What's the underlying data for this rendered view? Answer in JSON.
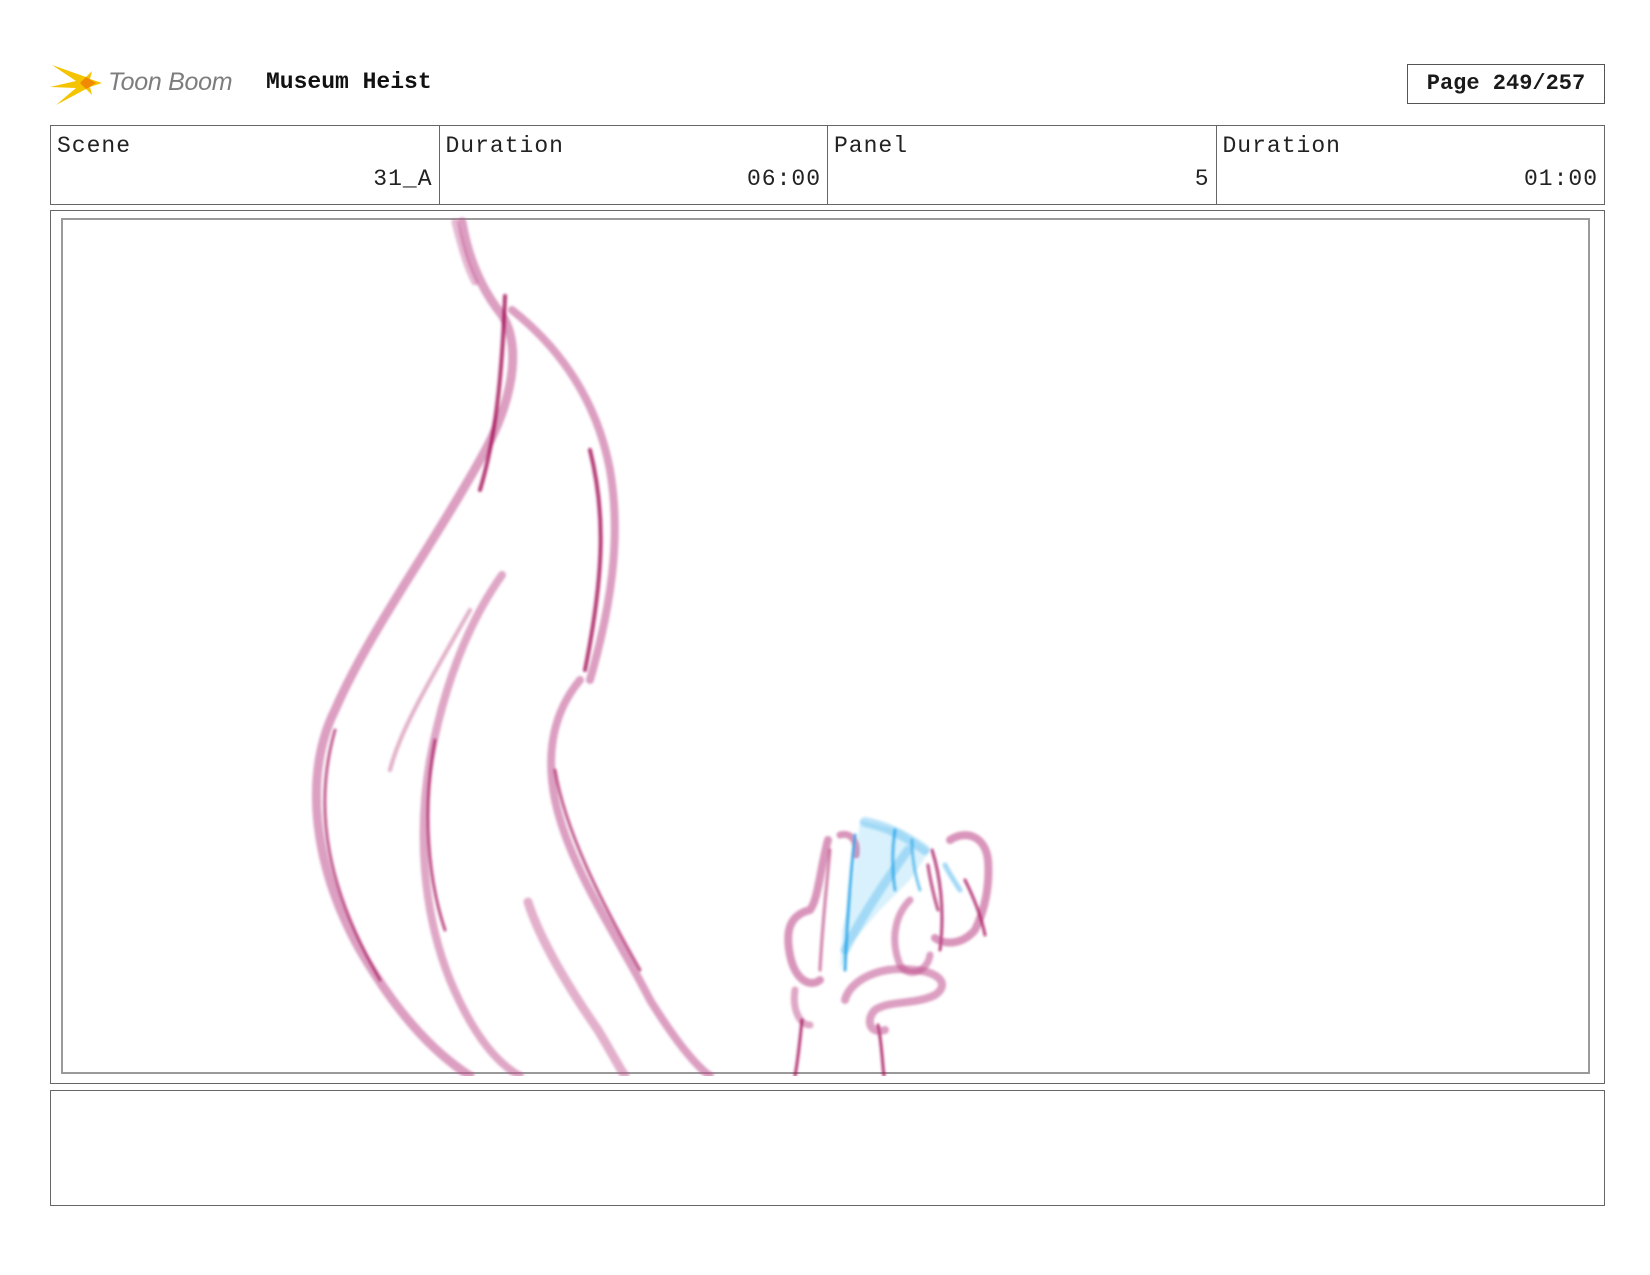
{
  "header": {
    "logo_text": "Toon Boom",
    "project_title": "Museum Heist",
    "page_label": "Page 249/257"
  },
  "info": {
    "scene_label": "Scene",
    "scene_value": "31_A",
    "scene_duration_label": "Duration",
    "scene_duration_value": "06:00",
    "panel_label": "Panel",
    "panel_value": "5",
    "panel_duration_label": "Duration",
    "panel_duration_value": "01:00"
  },
  "colors": {
    "sketch_magenta": "#a8145e",
    "sketch_blue": "#1ea1e8",
    "logo_yellow": "#f5c400",
    "logo_text": "#7d7d7d"
  },
  "icons": {
    "logo": "toon-boom-star-icon"
  },
  "notes": {
    "text": ""
  }
}
